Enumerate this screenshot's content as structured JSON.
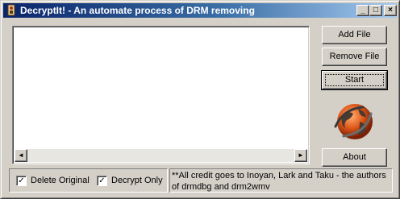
{
  "window": {
    "title": "DecryptIt! - An automate process of DRM removing",
    "min_glyph": "_",
    "max_glyph": "□",
    "close_glyph": "×"
  },
  "buttons": {
    "add_file": "Add File",
    "remove_file": "Remove File",
    "start": "Start",
    "about": "About"
  },
  "file_list": {
    "items": [],
    "scroll_left_glyph": "◄",
    "scroll_right_glyph": "►"
  },
  "options": {
    "delete_original": {
      "label": "Delete Original",
      "checked": true
    },
    "decrypt_only": {
      "label": "Decrypt Only",
      "checked": true
    },
    "check_glyph": "✓"
  },
  "credits": "**All credit goes to Inoyan, Lark and Taku - the authors of drmdbg and drm2wmv",
  "icons": {
    "app": "decryptit-app-icon",
    "logo": "orange-globe-icon"
  },
  "colors": {
    "titlebar_start": "#0a246a",
    "titlebar_end": "#a6caf0",
    "face": "#d4d0c8"
  }
}
